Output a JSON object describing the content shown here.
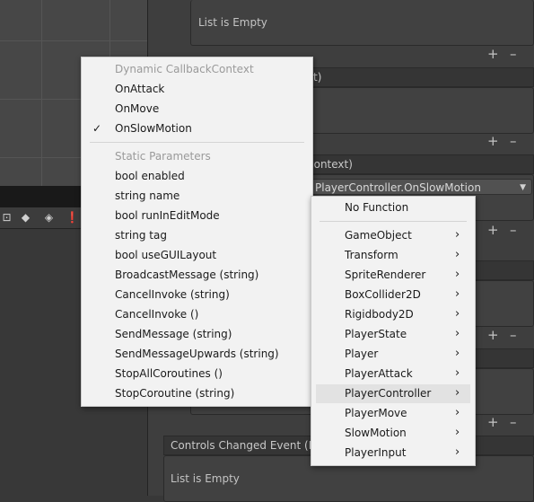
{
  "inspector": {
    "list_empty_1": "List is Empty",
    "header_2_suffix": "t)",
    "header_3_suffix": "context)",
    "function_dropdown": "PlayerController.OnSlowMotion",
    "header_last": "Controls Changed Event (Pl",
    "list_empty_last": "List is Empty",
    "plus": "+",
    "minus": "–"
  },
  "left_menu": {
    "dynamic_header": "Dynamic CallbackContext",
    "dynamic_items": [
      "OnAttack",
      "OnMove",
      "OnSlowMotion"
    ],
    "checked_item": "OnSlowMotion",
    "check_glyph": "✓",
    "static_header": "Static Parameters",
    "static_items": [
      "bool enabled",
      "string name",
      "bool runInEditMode",
      "string tag",
      "bool useGUILayout",
      "BroadcastMessage (string)",
      "CancelInvoke (string)",
      "CancelInvoke ()",
      "SendMessage (string)",
      "SendMessageUpwards (string)",
      "StopAllCoroutines ()",
      "StopCoroutine (string)"
    ]
  },
  "right_menu": {
    "no_function": "No Function",
    "items": [
      "GameObject",
      "Transform",
      "SpriteRenderer",
      "BoxCollider2D",
      "Rigidbody2D",
      "PlayerState",
      "Player",
      "PlayerAttack",
      "PlayerController",
      "PlayerMove",
      "SlowMotion",
      "PlayerInput"
    ],
    "highlighted": "PlayerController",
    "arrow_glyph": "›"
  },
  "toolbar_icons": [
    "scene-view-icon",
    "shapes-icon",
    "tag-icon",
    "warning-icon"
  ]
}
